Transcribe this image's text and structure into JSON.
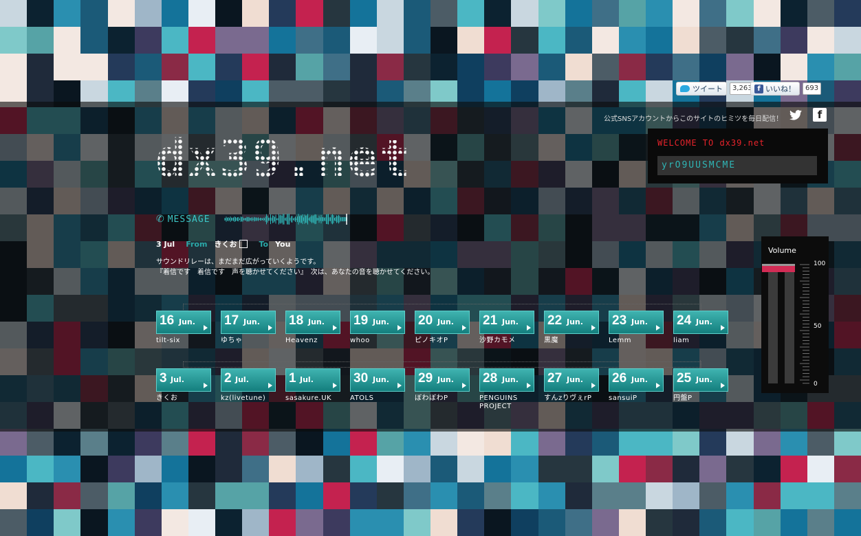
{
  "colors": {
    "accent": "#3cc6c6",
    "tile_top": "#3fb3b0",
    "tile_bottom": "#147f7e",
    "welcome_red": "#e8232b",
    "volume_knob": "#d22c55"
  },
  "social": {
    "tweet_label": "ツイート",
    "tweet_count": "3,263",
    "like_label": "いいね！",
    "like_count": "693",
    "sns_text": "公式SNSアカウントからこのサイトのヒミツを毎日配信！",
    "twitter_icon": "twitter-icon",
    "facebook_icon": "facebook-icon"
  },
  "logo": "dx39.net",
  "welcome": {
    "title": "WELCOME TO dx39.net",
    "code": "yrO9UUSMCME"
  },
  "message": {
    "label": "MESSAGE",
    "date": "3 Jul",
    "from_label": "From",
    "from": "きくお",
    "to_label": "To",
    "to": "You",
    "line1": "サウンドリレーは、まだまだ広がっていくようです。",
    "line2": "『着信です　着信です　声を聴かせてください』　次は、あなたの音を聴かせてください。"
  },
  "row1": [
    {
      "day": "16",
      "mon": "Jun.",
      "name": "tilt-six"
    },
    {
      "day": "17",
      "mon": "Jun.",
      "name": "ゆちゃ"
    },
    {
      "day": "18",
      "mon": "Jun.",
      "name": "Heavenz"
    },
    {
      "day": "19",
      "mon": "Jun.",
      "name": "whoo"
    },
    {
      "day": "20",
      "mon": "Jun.",
      "name": "ピノキオP"
    },
    {
      "day": "21",
      "mon": "Jun.",
      "name": "沙野カモメ"
    },
    {
      "day": "22",
      "mon": "Jun.",
      "name": "黒魔"
    },
    {
      "day": "23",
      "mon": "Jun.",
      "name": "Lemm"
    },
    {
      "day": "24",
      "mon": "Jun.",
      "name": "liam"
    }
  ],
  "row2": [
    {
      "day": "3",
      "mon": "Jul.",
      "name": "きくお"
    },
    {
      "day": "2",
      "mon": "Jul.",
      "name": "kz(livetune)"
    },
    {
      "day": "1",
      "mon": "Jul.",
      "name": "sasakure.UK"
    },
    {
      "day": "30",
      "mon": "Jun.",
      "name": "ATOLS"
    },
    {
      "day": "29",
      "mon": "Jun.",
      "name": "ぼわぼわP"
    },
    {
      "day": "28",
      "mon": "Jun.",
      "name": "PENGUINS PROJECT"
    },
    {
      "day": "27",
      "mon": "Jun.",
      "name": "すんzりヴぇrP"
    },
    {
      "day": "26",
      "mon": "Jun.",
      "name": "sansuiP"
    },
    {
      "day": "25",
      "mon": "Jun.",
      "name": "円盤P"
    }
  ],
  "volume": {
    "title": "Volume",
    "max_label": "100",
    "mid_label": "50",
    "min_label": "0",
    "level": 1.0
  }
}
